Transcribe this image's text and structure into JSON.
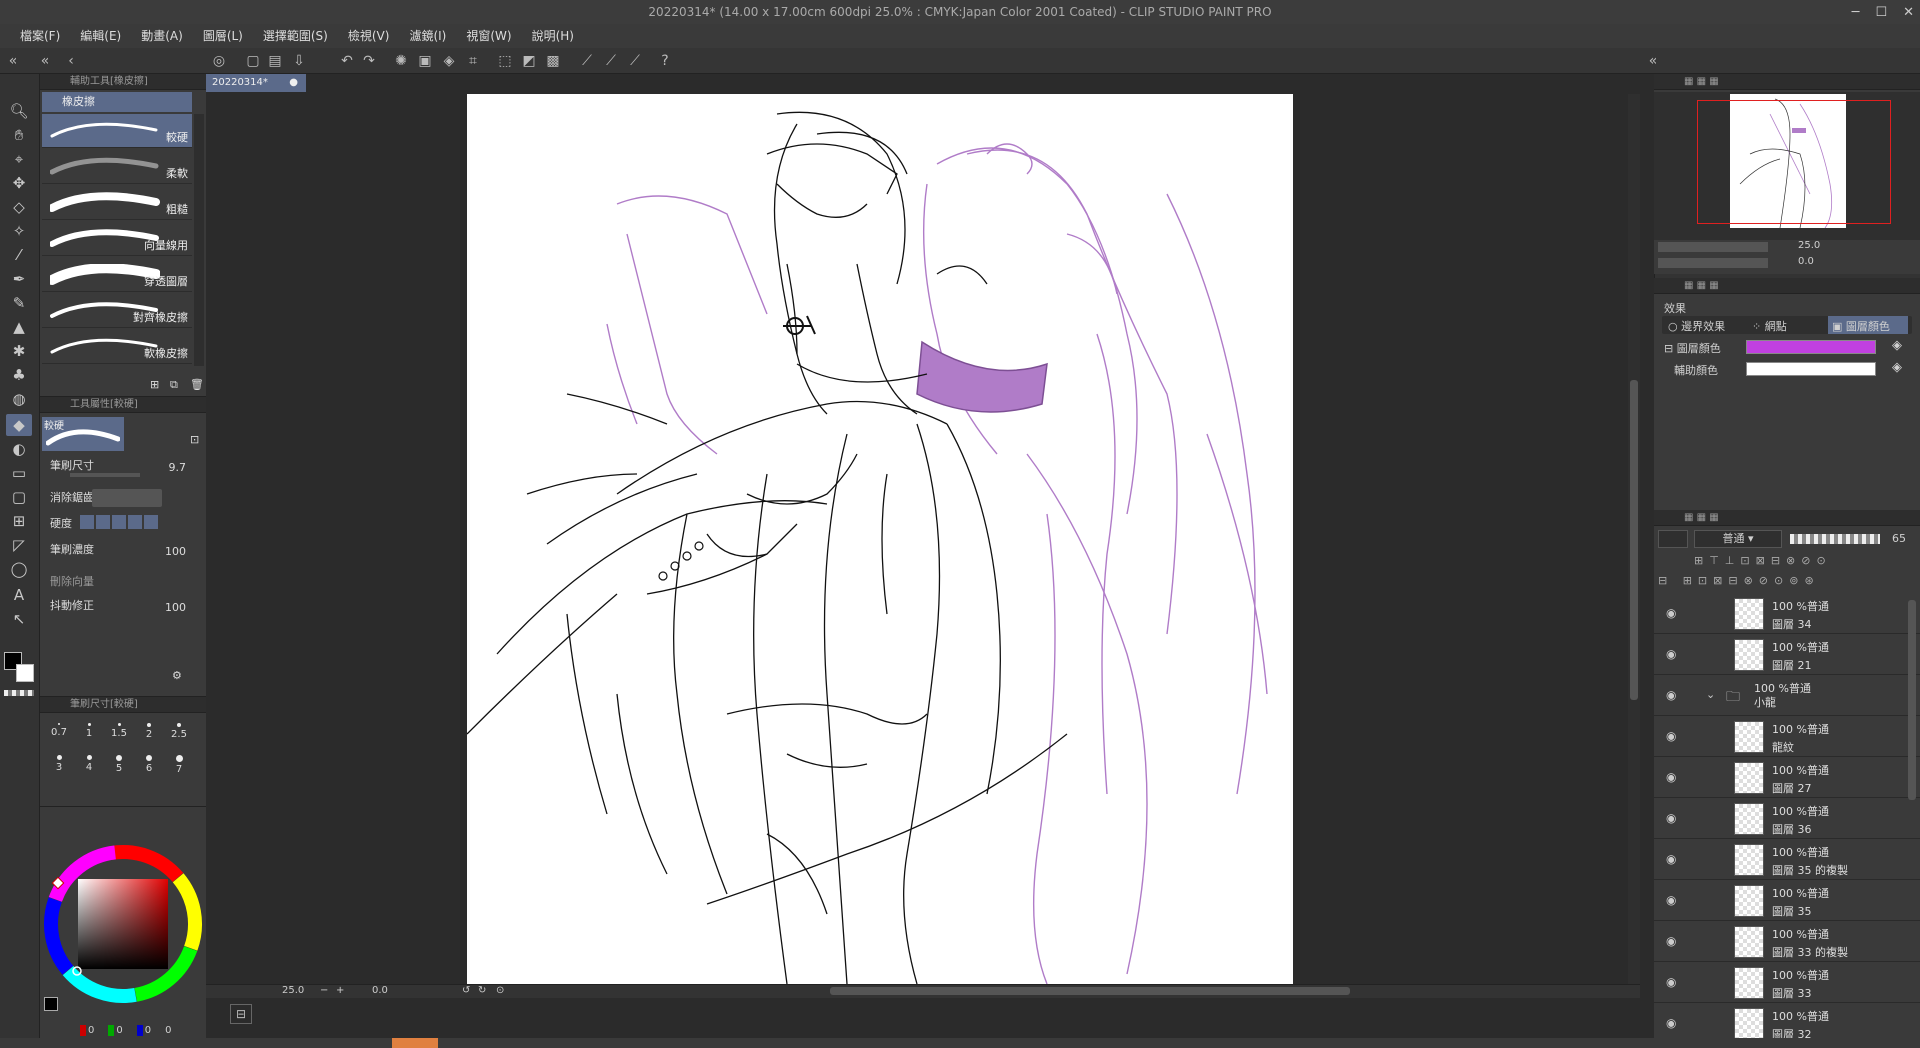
{
  "window": {
    "title": "20220314* (14.00 x 17.00cm 600dpi 25.0% : CMYK:Japan Color 2001 Coated)  - CLIP STUDIO PAINT PRO"
  },
  "menu": [
    "檔案(F)",
    "編輯(E)",
    "動畫(A)",
    "圖層(L)",
    "選擇範圍(S)",
    "檢視(V)",
    "濾鏡(I)",
    "視窗(W)",
    "說明(H)"
  ],
  "doc_tab": "20220314*",
  "subtool": {
    "header": "輔助工具[橡皮擦]",
    "group": "橡皮擦",
    "items": [
      {
        "label": "較硬",
        "selected": true
      },
      {
        "label": "柔軟",
        "selected": false
      },
      {
        "label": "粗糙",
        "selected": false
      },
      {
        "label": "向量線用",
        "selected": false
      },
      {
        "label": "穿透圖層",
        "selected": false
      },
      {
        "label": "對齊橡皮擦",
        "selected": false
      },
      {
        "label": "軟橡皮擦",
        "selected": false
      }
    ]
  },
  "tool_property": {
    "header": "工具屬性[較硬]",
    "preset": "較硬",
    "brush_size_label": "筆刷尺寸",
    "brush_size_value": "9.7",
    "antialias_label": "消除鋸齒",
    "hardness_label": "硬度",
    "density_label": "筆刷濃度",
    "density_value": "100",
    "vector_erase_label": "刪除向量",
    "stabilization_label": "抖動修正",
    "stabilization_value": "100"
  },
  "brush_size_panel": {
    "header": "筆刷尺寸[較硬]",
    "sizes": [
      "0.7",
      "1",
      "1.5",
      "2",
      "2.5",
      "3",
      "4",
      "5",
      "6",
      "7"
    ]
  },
  "color": {
    "main": "#000000",
    "sub": "#ffffff",
    "rgb_readout": [
      "0",
      "0",
      "0",
      "0"
    ]
  },
  "canvas_bottom": {
    "zoom": "25.0",
    "angle": "0.0"
  },
  "navigator": {
    "zoom": "25.0",
    "angle": "0.0"
  },
  "layer_property": {
    "title": "效果",
    "border_effect": "邊界效果",
    "halftone": "網點",
    "layer_color_btn": "圖層顏色",
    "layer_color_label": "圖層顏色",
    "layer_color": "#c040e0",
    "sub_color_label": "輔助顏色",
    "sub_color": "#ffffff"
  },
  "layers_panel": {
    "blend_mode": "普通",
    "opacity": "65",
    "layers": [
      {
        "mode": "100 %普通",
        "name": "圖層 34"
      },
      {
        "mode": "100 %普通",
        "name": "圖層 21"
      },
      {
        "mode": "100 %普通",
        "name": "小龍",
        "folder": true
      },
      {
        "mode": "100 %普通",
        "name": "龍紋"
      },
      {
        "mode": "100 %普通",
        "name": "圖層 27"
      },
      {
        "mode": "100 %普通",
        "name": "圖層 36"
      },
      {
        "mode": "100 %普通",
        "name": "圖層 35 的複製"
      },
      {
        "mode": "100 %普通",
        "name": "圖層 35"
      },
      {
        "mode": "100 %普通",
        "name": "圖層 33 的複製"
      },
      {
        "mode": "100 %普通",
        "name": "圖層 33"
      },
      {
        "mode": "100 %普通",
        "name": "圖層 32"
      }
    ]
  },
  "icons": {
    "tools": [
      "zoom-icon",
      "hand-icon",
      "operation-icon",
      "move-icon",
      "eraser-swatch-icon",
      "auto-select-icon",
      "eyedropper-icon",
      "pen-icon",
      "pencil-icon",
      "brush-icon",
      "airbrush-icon",
      "decoration-icon",
      "eraser-icon",
      "fill-icon",
      "gradient-icon",
      "figure-icon",
      "frame-icon",
      "ruler-icon",
      "lasso-icon",
      "text-icon",
      "correct-line-icon"
    ]
  }
}
